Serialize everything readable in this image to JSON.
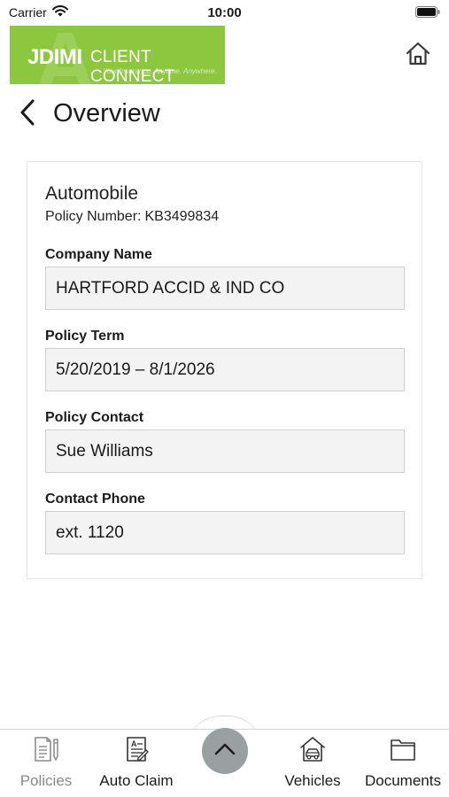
{
  "status_bar": {
    "carrier": "Carrier",
    "time": "10:00"
  },
  "header": {
    "logo_jdimi": "JDIMI",
    "logo_client_connect": "CLIENT CONNECT",
    "logo_tagline": "Your Insurance. Anytime. Anywhere.",
    "brand_color": "#8dc63f"
  },
  "nav": {
    "title": "Overview"
  },
  "policy": {
    "type": "Automobile",
    "number_label": "Policy Number:",
    "number": "KB3499834",
    "fields": [
      {
        "label": "Company Name",
        "value": "HARTFORD ACCID & IND CO"
      },
      {
        "label": "Policy Term",
        "value": "5/20/2019 – 8/1/2026"
      },
      {
        "label": "Policy Contact",
        "value": "Sue Williams"
      },
      {
        "label": "Contact Phone",
        "value": "ext. 1120"
      }
    ]
  },
  "tabs": [
    {
      "label": "Policies",
      "icon": "policies-icon",
      "active": true
    },
    {
      "label": "Auto Claim",
      "icon": "auto-claim-icon",
      "active": false
    },
    {
      "label": "Vehicles",
      "icon": "vehicles-icon",
      "active": false
    },
    {
      "label": "Documents",
      "icon": "documents-icon",
      "active": false
    }
  ]
}
